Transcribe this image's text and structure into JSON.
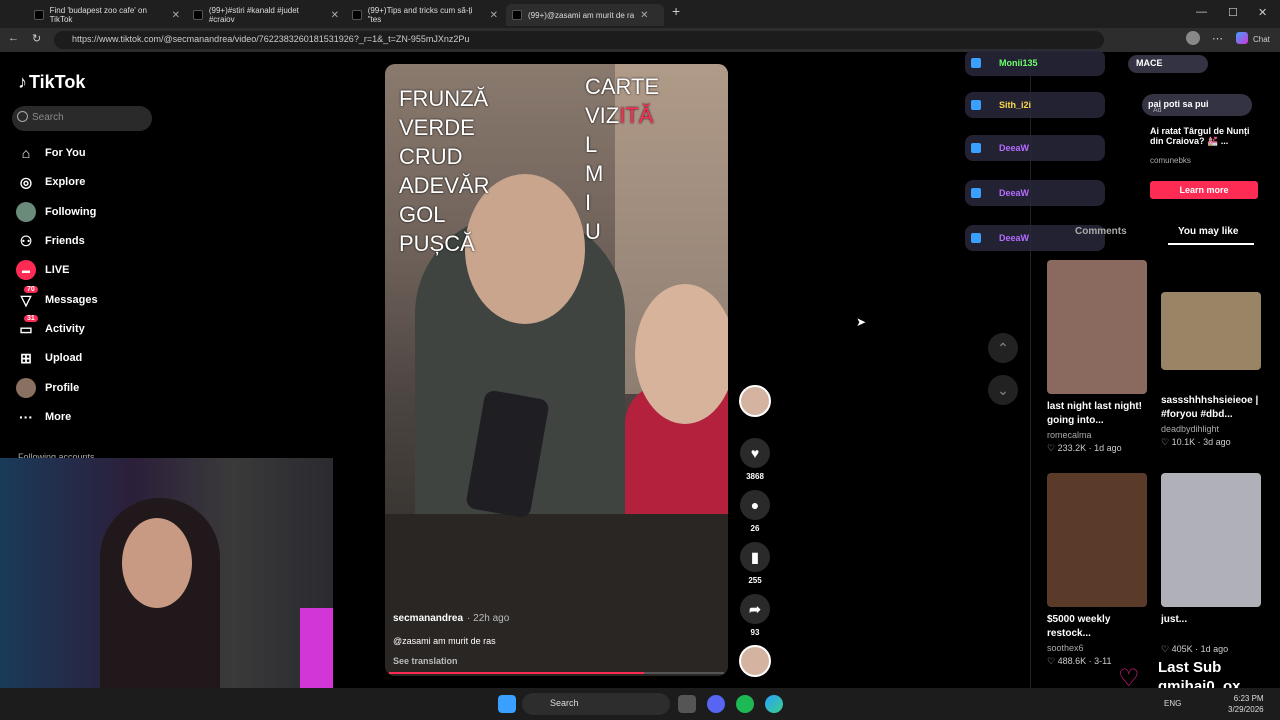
{
  "browser": {
    "tabs": [
      {
        "title": "Find 'budapest zoo cafe' on TikTok"
      },
      {
        "title": "(99+)#stiri #kanald #judet #craiov"
      },
      {
        "title": "(99+)Tips and tricks cum să-ți \"tes"
      },
      {
        "title": "(99+)@zasami am murit de ra"
      }
    ],
    "new_tab": "+",
    "url": "https://www.tiktok.com/@secmanandrea/video/7622383260181531926?_r=1&_t=ZN-955mJXnz2Pu",
    "chat_label": "Chat",
    "win_min": "—",
    "win_max": "☐",
    "win_close": "✕"
  },
  "sidebar": {
    "logo": "TikTok",
    "search_placeholder": "Search",
    "items": [
      {
        "label": "For You",
        "icon": "home-icon",
        "glyph": "⌂"
      },
      {
        "label": "Explore",
        "icon": "compass-icon",
        "glyph": "◎"
      },
      {
        "label": "Following",
        "icon": "avatar-icon",
        "glyph": "●"
      },
      {
        "label": "Friends",
        "icon": "friends-icon",
        "glyph": "👥"
      },
      {
        "label": "LIVE",
        "icon": "live-icon",
        "glyph": "●"
      },
      {
        "label": "Messages",
        "icon": "messages-icon",
        "glyph": "✉",
        "badge": "70"
      },
      {
        "label": "Activity",
        "icon": "activity-icon",
        "glyph": "☐",
        "badge": "31"
      },
      {
        "label": "Upload",
        "icon": "upload-icon",
        "glyph": "⊞"
      },
      {
        "label": "Profile",
        "icon": "profile-icon",
        "glyph": "●"
      },
      {
        "label": "More",
        "icon": "more-icon",
        "glyph": "···"
      }
    ],
    "following_accounts": "Following accounts"
  },
  "video": {
    "overlay_left": [
      "FRUNZĂ",
      "VERDE",
      "CRUD",
      "ADEVĂR",
      "GOL",
      "PUȘCĂ"
    ],
    "overlay_right_title": "CARTE",
    "overlay_right_viz": "VIZ",
    "overlay_right_ita": "ITĂ",
    "overlay_right_letters": [
      "L",
      "M",
      "I",
      "U"
    ],
    "author": "secmanandrea",
    "time_ago": "· 22h ago",
    "caption": "@zasami am murit de ras",
    "see_translation": "See translation",
    "progress": 0.76
  },
  "actions": {
    "likes": "3868",
    "comments": "26",
    "saves": "255",
    "shares": "93"
  },
  "overlays": {
    "pills": [
      "Monii135",
      "Sith_i2i",
      "DeeaW",
      "DeeaW",
      "DeeaW"
    ],
    "mace": "MACE",
    "top_pill": "pai poti sa pui",
    "ad_label": "Ad",
    "ad_title": "Ai ratat Târgul de Nunți din Craiova? 💒 ...",
    "ad_sub": "comunebks",
    "learn_more": "Learn more"
  },
  "panel": {
    "tabs": [
      "Comments",
      "You may like"
    ],
    "cards": [
      {
        "title": "last night last night! going into...",
        "author": "romecalma",
        "likes": "233.2K",
        "ago": "1d ago",
        "color": "#8a6a5e"
      },
      {
        "title": "sassshhhshsieieoe | #foryou #dbd...",
        "author": "deadbydihlight",
        "likes": "10.1K",
        "ago": "3d ago",
        "color": "#9a8466"
      },
      {
        "title": "$5000 weekly restock...",
        "author": "soothex6",
        "likes": "488.6K",
        "ago": "3-11",
        "color": "#5a3a28"
      },
      {
        "title": "just...",
        "author": "",
        "likes": "405K",
        "ago": "1d ago",
        "color": "#b0b0b8"
      }
    ]
  },
  "stream": {
    "last_sub_label": "Last Sub",
    "last_sub_name": "qmihai0_ox"
  },
  "taskbar": {
    "search": "Search",
    "lang": "ENG",
    "time": "6:23 PM",
    "date": "3/29/2026"
  }
}
